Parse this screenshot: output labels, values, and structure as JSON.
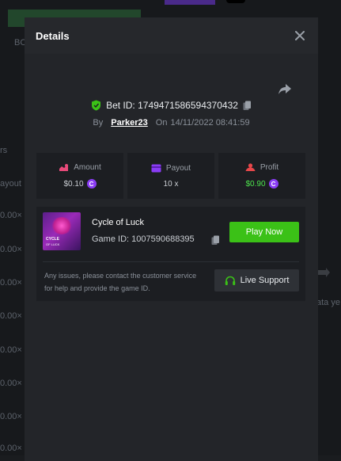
{
  "background": {
    "fragments": [
      {
        "text": "BC",
        "name": "bg-fragment-bc"
      },
      {
        "text": "rs",
        "name": "bg-fragment-rs"
      },
      {
        "text": "ayout",
        "name": "bg-fragment-payout"
      },
      {
        "text": "0.00×",
        "name": "bg-fragment-value"
      },
      {
        "text": "0.00×",
        "name": "bg-fragment-value"
      },
      {
        "text": "0.00×",
        "name": "bg-fragment-value"
      },
      {
        "text": "0.00×",
        "name": "bg-fragment-value"
      },
      {
        "text": "0.00×",
        "name": "bg-fragment-value"
      },
      {
        "text": "0.00×",
        "name": "bg-fragment-value"
      },
      {
        "text": "0.00×",
        "name": "bg-fragment-value"
      },
      {
        "text": "0.00×",
        "name": "bg-fragment-value"
      },
      {
        "text": "ata ye",
        "name": "bg-fragment-data"
      }
    ]
  },
  "modal": {
    "title": "Details",
    "bet": {
      "label": "Bet ID:",
      "id": "1749471586594370432",
      "by_label": "By",
      "user": "Parker23",
      "on_label": "On",
      "datetime": "14/11/2022 08:41:59"
    },
    "stats": [
      {
        "key": "amount",
        "label": "Amount",
        "value": "$0.10",
        "coin": true,
        "color": "#c9cdd2",
        "icon": "amount-icon"
      },
      {
        "key": "payout",
        "label": "Payout",
        "value": "10 x",
        "coin": false,
        "color": "#c9cdd2",
        "icon": "payout-icon"
      },
      {
        "key": "profit",
        "label": "Profit",
        "value": "$0.90",
        "coin": true,
        "color": "#4de64d",
        "icon": "profit-icon"
      }
    ],
    "game": {
      "name": "Cycle of Luck",
      "id_label": "Game ID:",
      "id": "1007590688395",
      "thumb_title": "CYCLE",
      "thumb_sub": "OF LUCK",
      "play_label": "Play Now"
    },
    "support": {
      "text": "Any issues, please contact the customer service for help and provide the game ID.",
      "button_label": "Live Support"
    },
    "colors": {
      "accent_green": "#3bc117",
      "profit_green": "#4de64d",
      "coin_purple": "#8a3cf5",
      "shield_green": "#3bc117"
    }
  }
}
